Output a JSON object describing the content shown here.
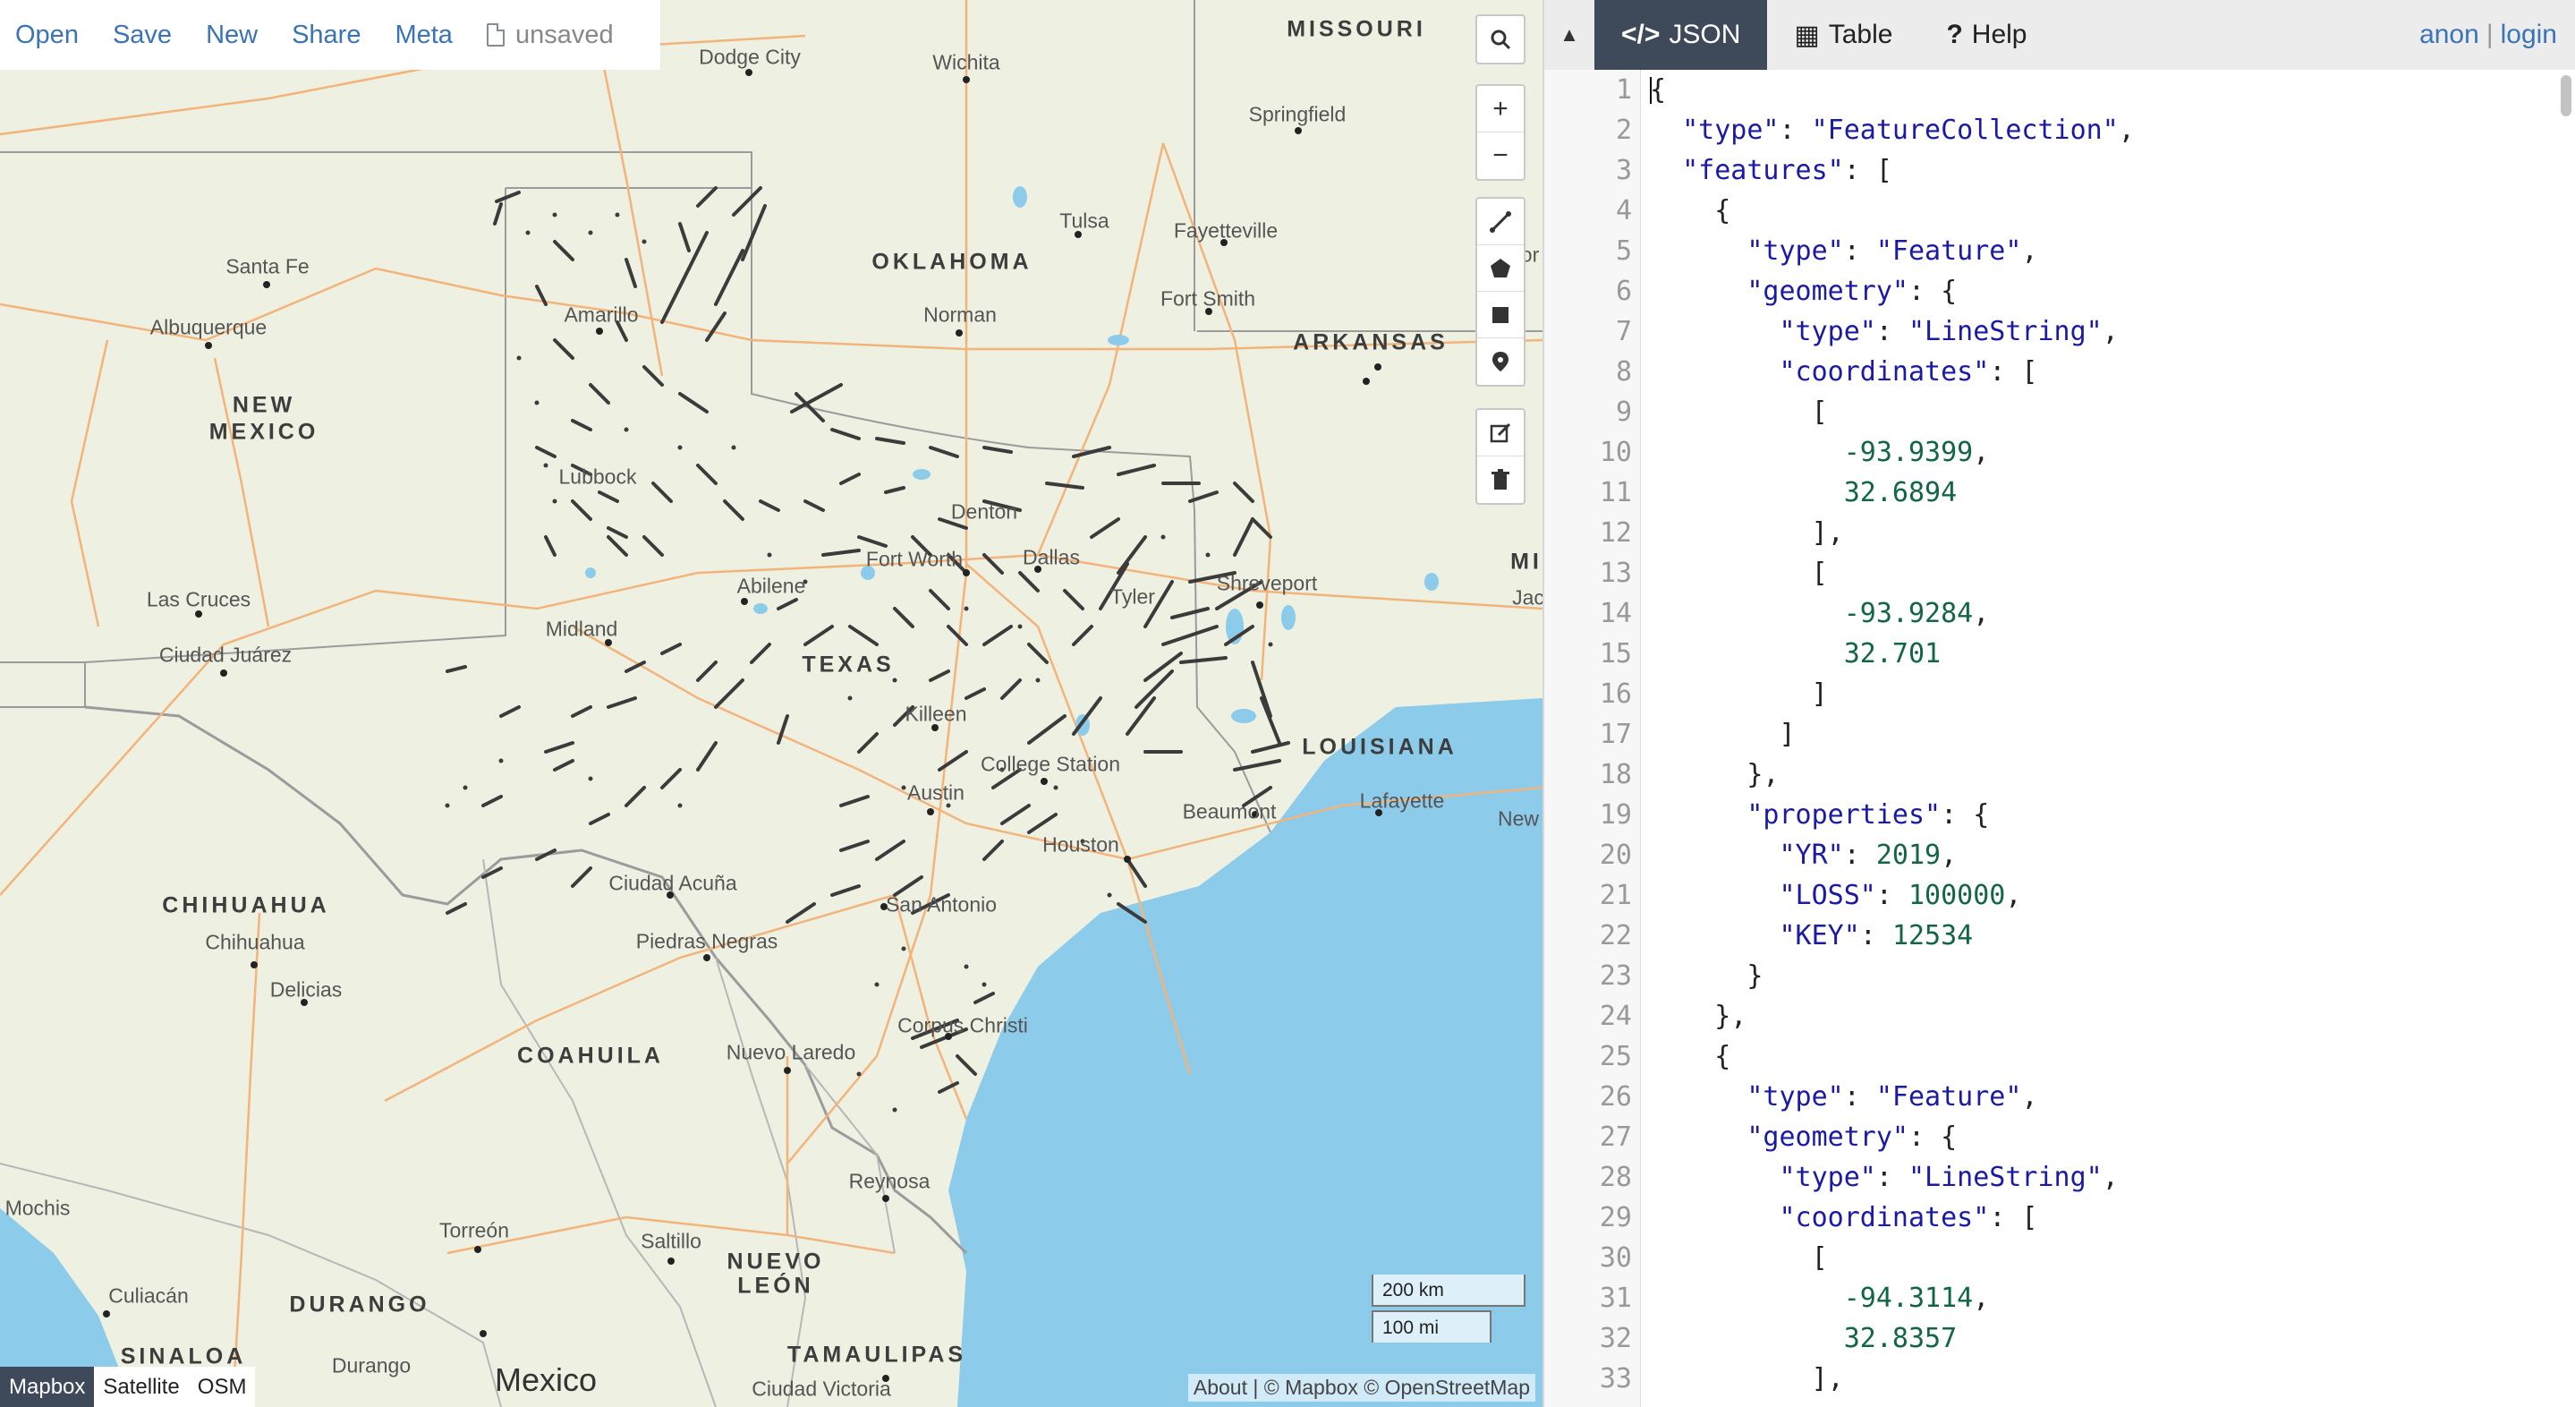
{
  "menu": {
    "items": [
      "Open",
      "Save",
      "New",
      "Share",
      "Meta"
    ],
    "status": "unsaved"
  },
  "map": {
    "state_labels": [
      "MISSOURI",
      "OKLAHOMA",
      "ARKANSAS",
      "NEW",
      "MEXICO",
      "TEXAS",
      "LOUISIANA",
      "CHIHUAHUA",
      "COAHUILA",
      "NUEVO",
      "LEÓN",
      "DURANGO",
      "TAMAULIPAS",
      "SINALOA",
      "MI"
    ],
    "city_labels": [
      "Dodge City",
      "Wichita",
      "Springfield",
      "Tulsa",
      "Fayetteville",
      "Santa Fe",
      "Amarillo",
      "Norman",
      "Fort Smith",
      "Albuquerque",
      "Lubbock",
      "Denton",
      "Fort Worth",
      "Dallas",
      "Shreveport",
      "Abilene",
      "Midland",
      "Las Cruces",
      "Ciudad Juárez",
      "Killeen",
      "College Station",
      "Austin",
      "Houston",
      "Beaumont",
      "Lafayette",
      "New",
      "Jac",
      "San Antonio",
      "Ciudad Acuña",
      "Chihuahua",
      "Delicias",
      "Piedras Negras",
      "Nuevo Laredo",
      "Corpus Christi",
      "Reynosa",
      "Torreón",
      "Saltillo",
      "Culiacán",
      "Durango",
      "Ciudad Victoria",
      "Mochis",
      "Tyler",
      "or"
    ],
    "country_label": "Mexico",
    "scale_km": "200 km",
    "scale_mi": "100 mi",
    "layers": [
      "Mapbox",
      "Satellite",
      "OSM"
    ],
    "active_layer": "Mapbox",
    "attribution": "About | © Mapbox © OpenStreetMap",
    "colors": {
      "land": "#eef0e2",
      "water": "#8ccbea",
      "roads": "#f2b47a",
      "tracks": "#3b3b3b",
      "border": "#9b9b9b"
    }
  },
  "toolbar": {
    "search_icon": "search-icon",
    "zoom_in": "+",
    "zoom_out": "−",
    "draw_tools": [
      "draw-line-icon",
      "draw-polygon-icon",
      "draw-rectangle-icon",
      "draw-marker-icon"
    ],
    "edit_tools": [
      "edit-icon",
      "trash-icon"
    ]
  },
  "panel": {
    "tabs": [
      {
        "icon": "</>",
        "label": "JSON"
      },
      {
        "icon": "▦",
        "label": "Table"
      },
      {
        "icon": "?",
        "label": "Help"
      }
    ],
    "collapse_icon": "▲",
    "auth": {
      "anon": "anon",
      "sep": "|",
      "login": "login"
    }
  },
  "json_lines": [
    "{",
    "  \"type\": \"FeatureCollection\",",
    "  \"features\": [",
    "    {",
    "      \"type\": \"Feature\",",
    "      \"geometry\": {",
    "        \"type\": \"LineString\",",
    "        \"coordinates\": [",
    "          [",
    "            -93.9399,",
    "            32.6894",
    "          ],",
    "          [",
    "            -93.9284,",
    "            32.701",
    "          ]",
    "        ]",
    "      },",
    "      \"properties\": {",
    "        \"YR\": 2019,",
    "        \"LOSS\": 100000,",
    "        \"KEY\": 12534",
    "      }",
    "    },",
    "    {",
    "      \"type\": \"Feature\",",
    "      \"geometry\": {",
    "        \"type\": \"LineString\",",
    "        \"coordinates\": [",
    "          [",
    "            -94.3114,",
    "            32.8357",
    "          ],"
  ]
}
